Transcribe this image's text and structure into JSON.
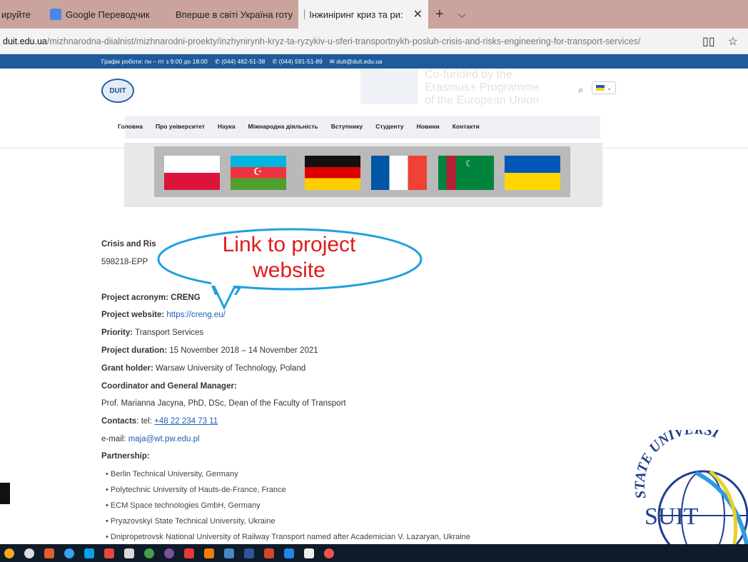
{
  "browser": {
    "tabs": [
      {
        "label": "ируйте",
        "color": "#c9a39c"
      },
      {
        "label": "Google Переводчик",
        "color": "#4a86e8"
      },
      {
        "label": "Вперше в світі Україна готу",
        "color": "#2d4b9a"
      },
      {
        "label": "Інжиніринг криз та ри:",
        "color": "#4d8fd6"
      }
    ],
    "close_label": "✕",
    "new_tab": "+",
    "tab_menu": "⌵",
    "url_domain": "duit.edu.ua",
    "url_path": "/mizhnarodna-diialnist/mizhnarodni-proekty/inzhynirynh-kryz-ta-ryzykiv-u-sferi-transportnykh-posluh-crisis-and-risks-engineering-for-transport-services/",
    "reader_icon": "book-icon",
    "favorite_icon": "star-icon"
  },
  "topstrip": {
    "hours": "Графік роботи: пн – пт з 9:00 до 18:00",
    "phone1": "✆ (044) 482-51-38",
    "phone2": "✆ (044) 591-51-89",
    "email": "✉ duit@duit.edu.ua"
  },
  "header": {
    "logo_text": "DUIT",
    "ghost_text": "Co-funded by the Erasmus+ Programme of the European Union",
    "search_icon": "⌕",
    "lang_arrow": "⌄"
  },
  "nav": [
    "Головна",
    "Про університет",
    "Наука",
    "Міжнародна діяльність",
    "Вступнику",
    "Студенту",
    "Новини",
    "Контакти"
  ],
  "content": {
    "title_partial": "Crisis and Ris",
    "code_partial": "598218-EPP",
    "acronym_label": "Project acronym:",
    "acronym_value": "CRENG",
    "website_label": "Project website:",
    "website_value": "https://creng.eu/",
    "priority_label": "Priority:",
    "priority_value": "Transport Services",
    "duration_label": "Project duration:",
    "duration_value": "15 November 2018 – 14 November 2021",
    "grant_label": "Grant holder:",
    "grant_value": "Warsaw University of Technology, Poland",
    "coordinator_label": "Coordinator and General Manager:",
    "coordinator_value": "Prof. Marianna Jacyna, PhD, DSc, Dean of the Faculty of Transport",
    "contacts_label": "Contacts",
    "contacts_text": ": tel: ",
    "contacts_phone": "+48 22 234 73 11",
    "email_label": "e-mail: ",
    "email_value": "maja@wt.pw.edu.pl",
    "partnership_label": "Partnership:",
    "partners": [
      "Berlin Technical University, Germany",
      "Polytechnic University of Hauts-de-France, France",
      "ECM Space technologies GmbH, Germany",
      "Pryazovskyi State Technical University, Ukraine",
      "Dnipropetrovsk National University of Railway Transport named after Academician V.  Lazaryan, Ukraine"
    ]
  },
  "callout": {
    "text_line1": "Link to project",
    "text_line2": "website"
  },
  "watermark": {
    "arc_text": "STATE UNIVERSI",
    "center_text": "SUIT"
  }
}
